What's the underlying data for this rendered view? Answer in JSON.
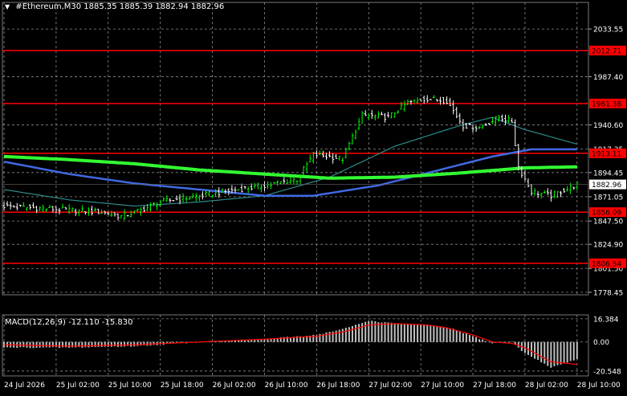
{
  "header": {
    "symbol": "#Ethereum,M30",
    "ohlc": "1885.35 1885.39 1882.94 1882.96",
    "macd_label": "MACD(12,26,9) -12.110 -15.830"
  },
  "colors": {
    "background": "#000000",
    "grid": "#8a8a8a",
    "bull_bar": "#00ff00",
    "bear_bar": "#ffffff",
    "level_line": "#ff0000",
    "ma_short": "#2e8b8b",
    "ma_mid": "#4169e1",
    "ma_long": "#32ff32",
    "macd_hist": "#c0c0c0",
    "macd_signal": "#ff0000",
    "axis_text": "#ffffff"
  },
  "chart_data": [
    {
      "type": "candlestick",
      "symbol": "#Ethereum",
      "timeframe": "M30",
      "ylim": [
        1776,
        2050
      ],
      "y_ticks": [
        2033.55,
        1987.4,
        1940.6,
        1917.35,
        1894.45,
        1871.05,
        1847.5,
        1824.9,
        1801.5,
        1778.45
      ],
      "y_tick_labels": [
        "2033.55",
        "1987.40",
        "1940.60",
        "1917.35",
        "1894.45",
        "1871.05",
        "1847.50",
        "1824.90",
        "1801.50",
        "1778.45"
      ],
      "x_ticks": [
        0,
        16,
        32,
        48,
        64,
        80,
        96,
        112,
        128,
        144,
        160,
        176
      ],
      "x_tick_labels": [
        "24 Jul 2026",
        "25 Jul 02:00",
        "25 Jul 10:00",
        "25 Jul 18:00",
        "26 Jul 02:00",
        "26 Jul 10:00",
        "26 Jul 18:00",
        "27 Jul 02:00",
        "27 Jul 10:00",
        "27 Jul 18:00",
        "28 Jul 02:00",
        "28 Jul 10:00"
      ],
      "current_price": 1882.96,
      "current_price_label": "1882.96",
      "levels": [
        {
          "value": 2012.71,
          "label": "2012.71"
        },
        {
          "value": 1961.38,
          "label": "1961.38"
        },
        {
          "value": 1913.11,
          "label": "1913.11"
        },
        {
          "value": 1856.09,
          "label": "1856.09"
        },
        {
          "value": 1806.54,
          "label": "1806.54"
        }
      ],
      "close_path": [
        [
          0,
          1862
        ],
        [
          10,
          1860
        ],
        [
          20,
          1858
        ],
        [
          30,
          1856
        ],
        [
          36,
          1852
        ],
        [
          42,
          1858
        ],
        [
          48,
          1866
        ],
        [
          56,
          1870
        ],
        [
          64,
          1874
        ],
        [
          72,
          1878
        ],
        [
          80,
          1882
        ],
        [
          90,
          1888
        ],
        [
          95,
          1912
        ],
        [
          104,
          1908
        ],
        [
          110,
          1950
        ],
        [
          118,
          1948
        ],
        [
          124,
          1962
        ],
        [
          130,
          1966
        ],
        [
          136,
          1964
        ],
        [
          141,
          1940
        ],
        [
          146,
          1938
        ],
        [
          152,
          1948
        ],
        [
          156,
          1944
        ],
        [
          158,
          1900
        ],
        [
          162,
          1876
        ],
        [
          168,
          1872
        ],
        [
          176,
          1883
        ]
      ],
      "ma_short_path": [
        [
          0,
          1878
        ],
        [
          20,
          1868
        ],
        [
          40,
          1862
        ],
        [
          60,
          1866
        ],
        [
          80,
          1872
        ],
        [
          100,
          1890
        ],
        [
          120,
          1920
        ],
        [
          140,
          1940
        ],
        [
          150,
          1948
        ],
        [
          160,
          1936
        ],
        [
          176,
          1922
        ]
      ],
      "ma_mid_path": [
        [
          0,
          1905
        ],
        [
          20,
          1893
        ],
        [
          40,
          1884
        ],
        [
          60,
          1878
        ],
        [
          80,
          1872
        ],
        [
          95,
          1872
        ],
        [
          115,
          1882
        ],
        [
          135,
          1898
        ],
        [
          150,
          1910
        ],
        [
          162,
          1917
        ],
        [
          176,
          1917
        ]
      ],
      "ma_long_path": [
        [
          0,
          1910
        ],
        [
          20,
          1907
        ],
        [
          40,
          1903
        ],
        [
          60,
          1897
        ],
        [
          80,
          1893
        ],
        [
          100,
          1889
        ],
        [
          120,
          1890
        ],
        [
          140,
          1894
        ],
        [
          160,
          1899
        ],
        [
          176,
          1900
        ]
      ]
    },
    {
      "type": "bar",
      "indicator": "MACD(12,26,9)",
      "ylim": [
        -24,
        18
      ],
      "y_ticks": [
        16.384,
        0.0,
        -20.548
      ],
      "y_tick_labels": [
        "16.384",
        "0.00",
        "-20.548"
      ],
      "main": -12.11,
      "signal": -15.83,
      "hist_path": [
        [
          0,
          -4
        ],
        [
          20,
          -4
        ],
        [
          40,
          -3
        ],
        [
          60,
          0
        ],
        [
          80,
          2
        ],
        [
          96,
          5
        ],
        [
          104,
          9
        ],
        [
          112,
          15
        ],
        [
          120,
          13
        ],
        [
          130,
          12
        ],
        [
          138,
          9
        ],
        [
          144,
          4
        ],
        [
          150,
          -1
        ],
        [
          156,
          0
        ],
        [
          160,
          -8
        ],
        [
          168,
          -18
        ],
        [
          176,
          -12
        ]
      ],
      "signal_path": [
        [
          0,
          -2
        ],
        [
          20,
          -3
        ],
        [
          40,
          -2
        ],
        [
          60,
          0
        ],
        [
          80,
          2
        ],
        [
          96,
          4
        ],
        [
          104,
          7
        ],
        [
          112,
          12
        ],
        [
          120,
          13
        ],
        [
          130,
          12
        ],
        [
          136,
          10
        ],
        [
          144,
          5
        ],
        [
          150,
          0
        ],
        [
          156,
          -1
        ],
        [
          160,
          -4
        ],
        [
          168,
          -14
        ],
        [
          176,
          -15.83
        ]
      ]
    }
  ]
}
